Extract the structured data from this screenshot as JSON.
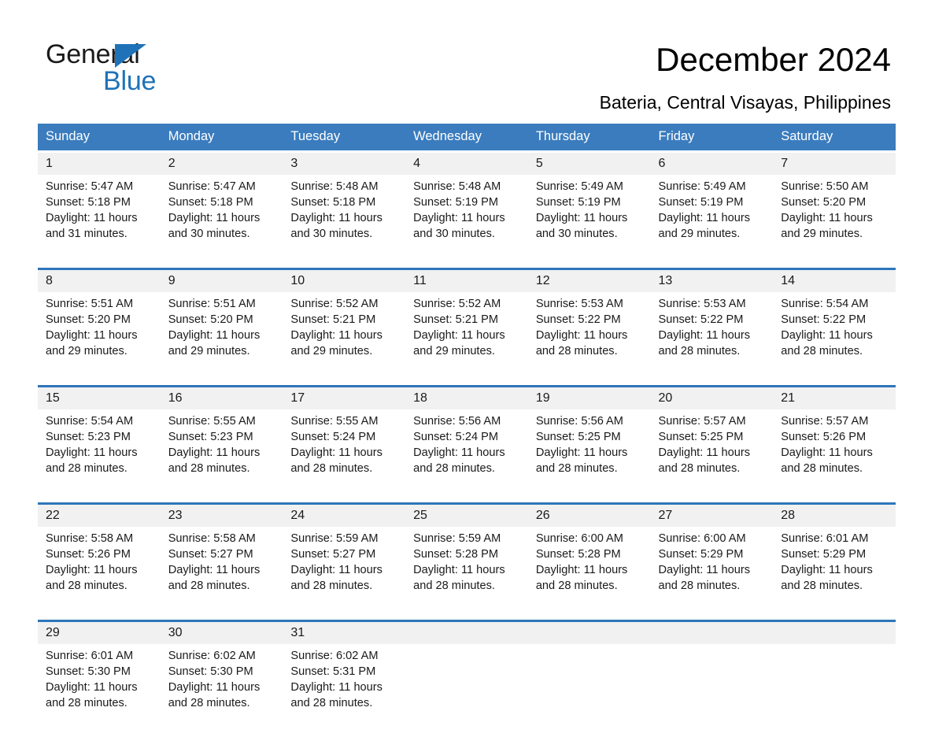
{
  "brand": {
    "name_part1": "General",
    "name_part2": "Blue",
    "triangle_color": "#1f72b8"
  },
  "header": {
    "title": "December 2024",
    "location": "Bateria, Central Visayas, Philippines"
  },
  "theme": {
    "header_blue": "#3a7cbe",
    "rule_blue": "#2e76ba",
    "daynum_band": "#f1f1f1",
    "text": "#1a1a1a"
  },
  "weekday_headers": [
    "Sunday",
    "Monday",
    "Tuesday",
    "Wednesday",
    "Thursday",
    "Friday",
    "Saturday"
  ],
  "weeks": [
    [
      {
        "day": "1",
        "sunrise": "Sunrise: 5:47 AM",
        "sunset": "Sunset: 5:18 PM",
        "daylight": "Daylight: 11 hours and 31 minutes."
      },
      {
        "day": "2",
        "sunrise": "Sunrise: 5:47 AM",
        "sunset": "Sunset: 5:18 PM",
        "daylight": "Daylight: 11 hours and 30 minutes."
      },
      {
        "day": "3",
        "sunrise": "Sunrise: 5:48 AM",
        "sunset": "Sunset: 5:18 PM",
        "daylight": "Daylight: 11 hours and 30 minutes."
      },
      {
        "day": "4",
        "sunrise": "Sunrise: 5:48 AM",
        "sunset": "Sunset: 5:19 PM",
        "daylight": "Daylight: 11 hours and 30 minutes."
      },
      {
        "day": "5",
        "sunrise": "Sunrise: 5:49 AM",
        "sunset": "Sunset: 5:19 PM",
        "daylight": "Daylight: 11 hours and 30 minutes."
      },
      {
        "day": "6",
        "sunrise": "Sunrise: 5:49 AM",
        "sunset": "Sunset: 5:19 PM",
        "daylight": "Daylight: 11 hours and 29 minutes."
      },
      {
        "day": "7",
        "sunrise": "Sunrise: 5:50 AM",
        "sunset": "Sunset: 5:20 PM",
        "daylight": "Daylight: 11 hours and 29 minutes."
      }
    ],
    [
      {
        "day": "8",
        "sunrise": "Sunrise: 5:51 AM",
        "sunset": "Sunset: 5:20 PM",
        "daylight": "Daylight: 11 hours and 29 minutes."
      },
      {
        "day": "9",
        "sunrise": "Sunrise: 5:51 AM",
        "sunset": "Sunset: 5:20 PM",
        "daylight": "Daylight: 11 hours and 29 minutes."
      },
      {
        "day": "10",
        "sunrise": "Sunrise: 5:52 AM",
        "sunset": "Sunset: 5:21 PM",
        "daylight": "Daylight: 11 hours and 29 minutes."
      },
      {
        "day": "11",
        "sunrise": "Sunrise: 5:52 AM",
        "sunset": "Sunset: 5:21 PM",
        "daylight": "Daylight: 11 hours and 29 minutes."
      },
      {
        "day": "12",
        "sunrise": "Sunrise: 5:53 AM",
        "sunset": "Sunset: 5:22 PM",
        "daylight": "Daylight: 11 hours and 28 minutes."
      },
      {
        "day": "13",
        "sunrise": "Sunrise: 5:53 AM",
        "sunset": "Sunset: 5:22 PM",
        "daylight": "Daylight: 11 hours and 28 minutes."
      },
      {
        "day": "14",
        "sunrise": "Sunrise: 5:54 AM",
        "sunset": "Sunset: 5:22 PM",
        "daylight": "Daylight: 11 hours and 28 minutes."
      }
    ],
    [
      {
        "day": "15",
        "sunrise": "Sunrise: 5:54 AM",
        "sunset": "Sunset: 5:23 PM",
        "daylight": "Daylight: 11 hours and 28 minutes."
      },
      {
        "day": "16",
        "sunrise": "Sunrise: 5:55 AM",
        "sunset": "Sunset: 5:23 PM",
        "daylight": "Daylight: 11 hours and 28 minutes."
      },
      {
        "day": "17",
        "sunrise": "Sunrise: 5:55 AM",
        "sunset": "Sunset: 5:24 PM",
        "daylight": "Daylight: 11 hours and 28 minutes."
      },
      {
        "day": "18",
        "sunrise": "Sunrise: 5:56 AM",
        "sunset": "Sunset: 5:24 PM",
        "daylight": "Daylight: 11 hours and 28 minutes."
      },
      {
        "day": "19",
        "sunrise": "Sunrise: 5:56 AM",
        "sunset": "Sunset: 5:25 PM",
        "daylight": "Daylight: 11 hours and 28 minutes."
      },
      {
        "day": "20",
        "sunrise": "Sunrise: 5:57 AM",
        "sunset": "Sunset: 5:25 PM",
        "daylight": "Daylight: 11 hours and 28 minutes."
      },
      {
        "day": "21",
        "sunrise": "Sunrise: 5:57 AM",
        "sunset": "Sunset: 5:26 PM",
        "daylight": "Daylight: 11 hours and 28 minutes."
      }
    ],
    [
      {
        "day": "22",
        "sunrise": "Sunrise: 5:58 AM",
        "sunset": "Sunset: 5:26 PM",
        "daylight": "Daylight: 11 hours and 28 minutes."
      },
      {
        "day": "23",
        "sunrise": "Sunrise: 5:58 AM",
        "sunset": "Sunset: 5:27 PM",
        "daylight": "Daylight: 11 hours and 28 minutes."
      },
      {
        "day": "24",
        "sunrise": "Sunrise: 5:59 AM",
        "sunset": "Sunset: 5:27 PM",
        "daylight": "Daylight: 11 hours and 28 minutes."
      },
      {
        "day": "25",
        "sunrise": "Sunrise: 5:59 AM",
        "sunset": "Sunset: 5:28 PM",
        "daylight": "Daylight: 11 hours and 28 minutes."
      },
      {
        "day": "26",
        "sunrise": "Sunrise: 6:00 AM",
        "sunset": "Sunset: 5:28 PM",
        "daylight": "Daylight: 11 hours and 28 minutes."
      },
      {
        "day": "27",
        "sunrise": "Sunrise: 6:00 AM",
        "sunset": "Sunset: 5:29 PM",
        "daylight": "Daylight: 11 hours and 28 minutes."
      },
      {
        "day": "28",
        "sunrise": "Sunrise: 6:01 AM",
        "sunset": "Sunset: 5:29 PM",
        "daylight": "Daylight: 11 hours and 28 minutes."
      }
    ],
    [
      {
        "day": "29",
        "sunrise": "Sunrise: 6:01 AM",
        "sunset": "Sunset: 5:30 PM",
        "daylight": "Daylight: 11 hours and 28 minutes."
      },
      {
        "day": "30",
        "sunrise": "Sunrise: 6:02 AM",
        "sunset": "Sunset: 5:30 PM",
        "daylight": "Daylight: 11 hours and 28 minutes."
      },
      {
        "day": "31",
        "sunrise": "Sunrise: 6:02 AM",
        "sunset": "Sunset: 5:31 PM",
        "daylight": "Daylight: 11 hours and 28 minutes."
      },
      {
        "day": "",
        "sunrise": "",
        "sunset": "",
        "daylight": ""
      },
      {
        "day": "",
        "sunrise": "",
        "sunset": "",
        "daylight": ""
      },
      {
        "day": "",
        "sunrise": "",
        "sunset": "",
        "daylight": ""
      },
      {
        "day": "",
        "sunrise": "",
        "sunset": "",
        "daylight": ""
      }
    ]
  ]
}
